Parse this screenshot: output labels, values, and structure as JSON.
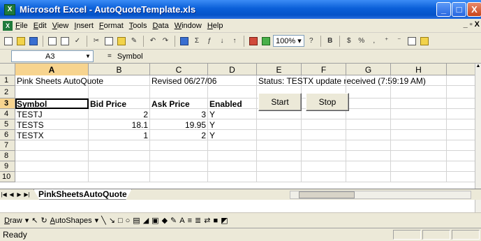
{
  "window": {
    "title": "Microsoft Excel - AutoQuoteTemplate.xls",
    "app_icon": "X",
    "min_label": "_",
    "max_label": "□",
    "close_label": "X"
  },
  "menu": {
    "items": [
      "File",
      "Edit",
      "View",
      "Insert",
      "Format",
      "Tools",
      "Data",
      "Window",
      "Help"
    ],
    "doc_min": "_",
    "doc_restore": "▫",
    "doc_close": "X"
  },
  "toolbar": {
    "zoom": "100%",
    "bold_label": "B",
    "currency_label": "$",
    "percent_label": "%",
    "comma_label": ","
  },
  "formula_bar": {
    "cell_ref": "A3",
    "fx_label": "=",
    "value": "Symbol"
  },
  "columns": [
    "A",
    "B",
    "C",
    "D",
    "E",
    "F",
    "G",
    "H"
  ],
  "rows": [
    {
      "num": "1",
      "cells": [
        "Pink Sheets AutoQuote",
        "",
        "Revised 06/27/06",
        "",
        "Status: TESTX update received (7:59:19 AM)",
        "",
        "",
        ""
      ]
    },
    {
      "num": "2",
      "cells": [
        "",
        "",
        "",
        "",
        "",
        "",
        "",
        ""
      ]
    },
    {
      "num": "3",
      "cells": [
        "Symbol",
        "Bid Price",
        "Ask Price",
        "Enabled",
        "",
        "",
        "",
        ""
      ]
    },
    {
      "num": "4",
      "cells": [
        "TESTJ",
        "2",
        "3",
        "Y",
        "",
        "",
        "",
        ""
      ]
    },
    {
      "num": "5",
      "cells": [
        "TESTS",
        "18.1",
        "19.95",
        "Y",
        "",
        "",
        "",
        ""
      ]
    },
    {
      "num": "6",
      "cells": [
        "TESTX",
        "1",
        "2",
        "Y",
        "",
        "",
        "",
        ""
      ]
    },
    {
      "num": "7",
      "cells": [
        "",
        "",
        "",
        "",
        "",
        "",
        "",
        ""
      ]
    },
    {
      "num": "8",
      "cells": [
        "",
        "",
        "",
        "",
        "",
        "",
        "",
        ""
      ]
    },
    {
      "num": "9",
      "cells": [
        "",
        "",
        "",
        "",
        "",
        "",
        "",
        ""
      ]
    },
    {
      "num": "10",
      "cells": [
        "",
        "",
        "",
        "",
        "",
        "",
        "",
        ""
      ]
    }
  ],
  "sheet_buttons": {
    "start": "Start",
    "stop": "Stop"
  },
  "sheet_tabs": {
    "active": "PinkSheetsAutoQuote"
  },
  "drawing_toolbar": {
    "draw_label": "Draw",
    "autoshapes_label": "AutoShapes"
  },
  "status_bar": {
    "text": "Ready"
  }
}
